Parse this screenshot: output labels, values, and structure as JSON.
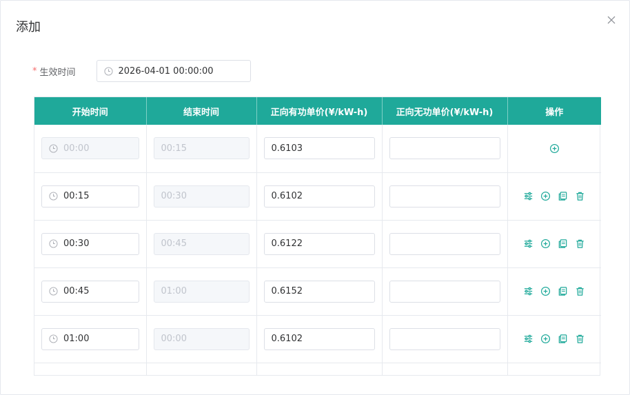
{
  "dialog": {
    "title": "添加"
  },
  "effective": {
    "required_mark": "*",
    "label": "生效时间",
    "value": "2026-04-01 00:00:00"
  },
  "table": {
    "headers": [
      "开始时间",
      "结束时间",
      "正向有功单价(¥/kW-h)",
      "正向无功单价(¥/kW-h)",
      "操作"
    ],
    "rows": [
      {
        "start": "00:00",
        "end": "00:15",
        "active_price": "0.6103",
        "reactive_price": "",
        "start_disabled": true
      },
      {
        "start": "00:15",
        "end": "00:30",
        "active_price": "0.6102",
        "reactive_price": "",
        "start_disabled": false
      },
      {
        "start": "00:30",
        "end": "00:45",
        "active_price": "0.6122",
        "reactive_price": "",
        "start_disabled": false
      },
      {
        "start": "00:45",
        "end": "01:00",
        "active_price": "0.6152",
        "reactive_price": "",
        "start_disabled": false
      },
      {
        "start": "01:00",
        "end": "00:00",
        "active_price": "0.6102",
        "reactive_price": "",
        "start_disabled": false
      }
    ]
  },
  "colors": {
    "accent": "#1fa99a",
    "required": "#f56c6c"
  },
  "icons": [
    "clock-icon",
    "close-icon",
    "adjust-icon",
    "add-circle-icon",
    "copy-icon",
    "delete-icon"
  ]
}
